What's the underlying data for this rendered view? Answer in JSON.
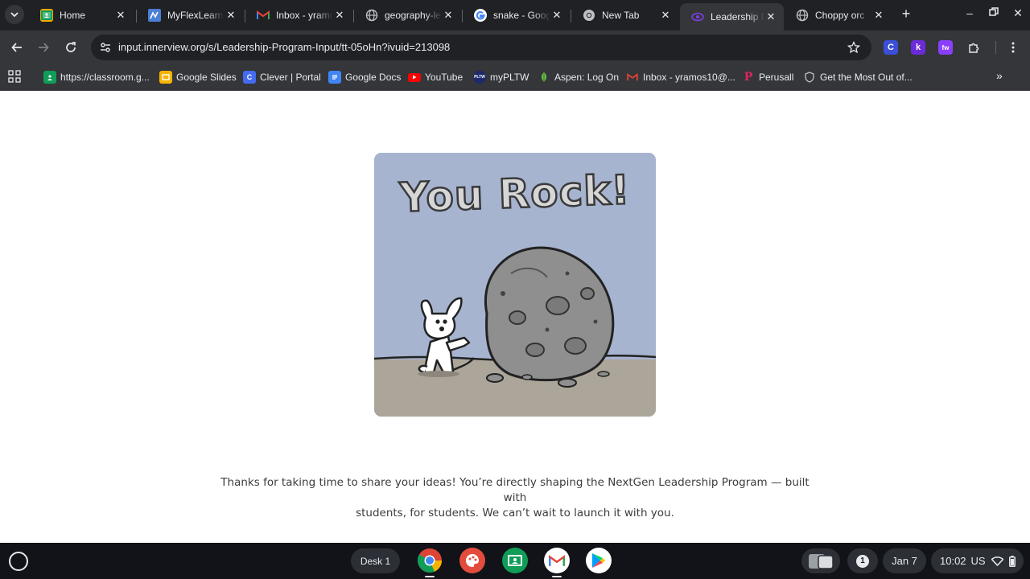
{
  "browser": {
    "tabs": [
      {
        "title": "Home",
        "favicon": "google-classroom-icon",
        "active": false
      },
      {
        "title": "MyFlexLearning",
        "favicon": "myflexlearning-icon",
        "active": false
      },
      {
        "title": "Inbox - yramos",
        "favicon": "gmail-icon",
        "active": false
      },
      {
        "title": "geography-le",
        "favicon": "globe-icon",
        "active": false
      },
      {
        "title": "snake - Google",
        "favicon": "google-icon",
        "active": false
      },
      {
        "title": "New Tab",
        "favicon": "chrome-icon",
        "active": false
      },
      {
        "title": "Leadership Pr",
        "favicon": "innerview-icon",
        "active": true
      },
      {
        "title": "Choppy orc",
        "favicon": "globe-icon",
        "active": false
      }
    ],
    "url": {
      "host": "input.innerview.org",
      "path": "/s/Leadership-Program-Input/tt-05oHn?ivuid=213098"
    },
    "extensions": [
      {
        "letter": "C",
        "color": "#3b4fd8"
      },
      {
        "letter": "k",
        "color": "#6c2bd9"
      },
      {
        "letter": "fw",
        "color": "#8a3ffc"
      }
    ],
    "bookmarks": [
      {
        "label": "https://classroom.g...",
        "icon": "google-classroom-icon"
      },
      {
        "label": "Google Slides",
        "icon": "google-slides-icon"
      },
      {
        "label": "Clever | Portal",
        "icon": "clever-icon"
      },
      {
        "label": "Google Docs",
        "icon": "google-docs-icon"
      },
      {
        "label": "YouTube",
        "icon": "youtube-icon"
      },
      {
        "label": "myPLTW",
        "icon": "pltw-icon"
      },
      {
        "label": "Aspen: Log On",
        "icon": "aspen-icon"
      },
      {
        "label": "Inbox - yramos10@...",
        "icon": "gmail-icon"
      },
      {
        "label": "Perusall",
        "icon": "perusall-icon"
      },
      {
        "label": "Get the Most Out of...",
        "icon": "shield-icon"
      }
    ]
  },
  "page": {
    "image_text": "You Rock!",
    "thanks_line1": "Thanks for taking  time to share your ideas! You’re directly shaping the NextGen Leadership Program — built with",
    "thanks_line2": "students, for students. We can’t wait to launch it with you."
  },
  "shelf": {
    "desk_label": "Desk 1",
    "apps": [
      "chrome-icon",
      "canvas-icon",
      "google-classroom-icon",
      "gmail-icon",
      "play-store-icon"
    ],
    "notification_count": "1",
    "date": "Jan 7",
    "time": "10:02",
    "locale": "US"
  }
}
